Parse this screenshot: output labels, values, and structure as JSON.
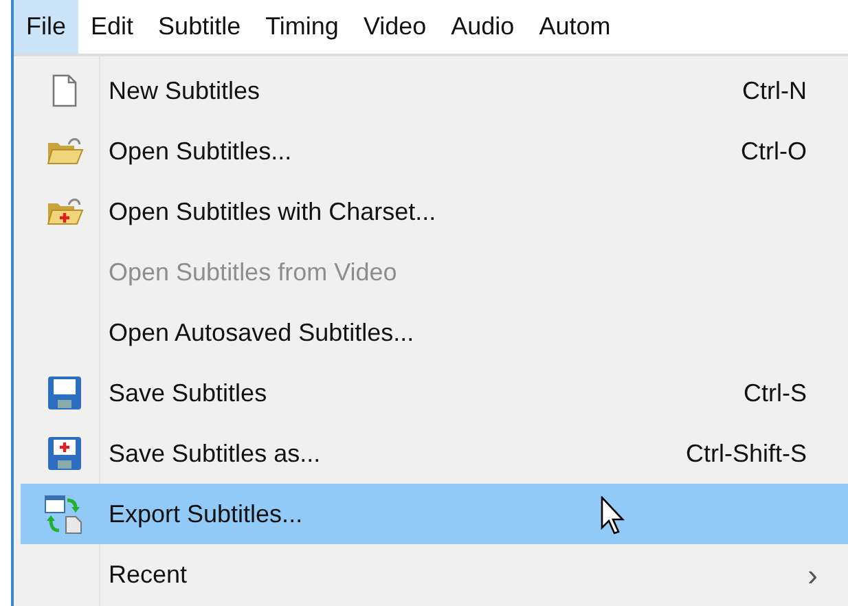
{
  "menubar": [
    {
      "label": "File",
      "selected": true
    },
    {
      "label": "Edit",
      "selected": false
    },
    {
      "label": "Subtitle",
      "selected": false
    },
    {
      "label": "Timing",
      "selected": false
    },
    {
      "label": "Video",
      "selected": false
    },
    {
      "label": "Audio",
      "selected": false
    },
    {
      "label": "Autom",
      "selected": false
    }
  ],
  "menu": [
    {
      "label": "New Subtitles",
      "shortcut": "Ctrl-N",
      "disabled": false,
      "selected": false
    },
    {
      "label": "Open Subtitles...",
      "shortcut": "Ctrl-O",
      "disabled": false,
      "selected": false
    },
    {
      "label": "Open Subtitles with Charset...",
      "disabled": false,
      "selected": false
    },
    {
      "label": "Open Subtitles from Video",
      "disabled": true,
      "selected": false
    },
    {
      "label": "Open Autosaved Subtitles...",
      "disabled": false,
      "selected": false
    },
    {
      "label": "Save Subtitles",
      "shortcut": "Ctrl-S",
      "disabled": false,
      "selected": false
    },
    {
      "label": "Save Subtitles as...",
      "shortcut": "Ctrl-Shift-S",
      "disabled": false,
      "selected": false
    },
    {
      "label": "Export Subtitles...",
      "disabled": false,
      "selected": true
    },
    {
      "label": "Recent",
      "submenu_arrow": "›",
      "disabled": false,
      "selected": false
    }
  ]
}
